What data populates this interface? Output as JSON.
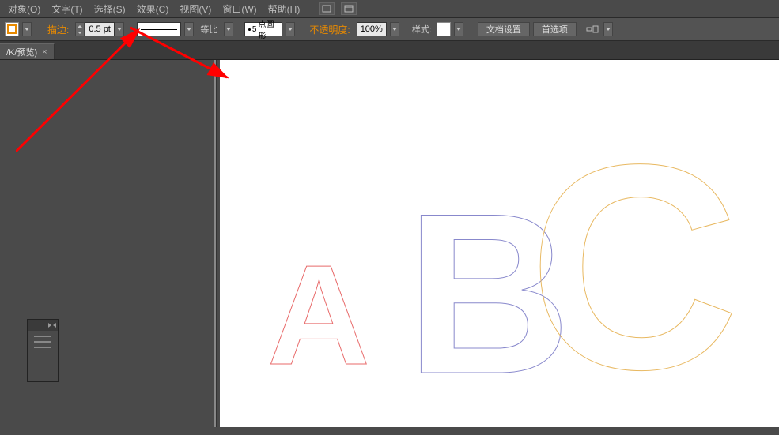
{
  "menubar": {
    "items": [
      {
        "label": "对象(O)"
      },
      {
        "label": "文字(T)"
      },
      {
        "label": "选择(S)"
      },
      {
        "label": "效果(C)"
      },
      {
        "label": "视图(V)"
      },
      {
        "label": "窗口(W)"
      },
      {
        "label": "帮助(H)"
      }
    ]
  },
  "toolbar": {
    "stroke_label": "描边:",
    "stroke_weight": "0.5 pt",
    "proportion_label": "等比",
    "brush_size": "5",
    "brush_shape": "点圆形",
    "opacity_label": "不透明度:",
    "opacity_value": "100%",
    "style_label": "样式:",
    "doc_setup_btn": "文档设置",
    "prefs_btn": "首选项"
  },
  "tabs": {
    "doc1": "/K/预览)"
  },
  "letters": {
    "a": "A",
    "b": "B",
    "c": "C"
  },
  "colors": {
    "accent": "#e88a00",
    "letter_a": "#e86a6a",
    "letter_b": "#8888cc",
    "letter_c": "#e8b860",
    "annotation": "#ff0000"
  }
}
